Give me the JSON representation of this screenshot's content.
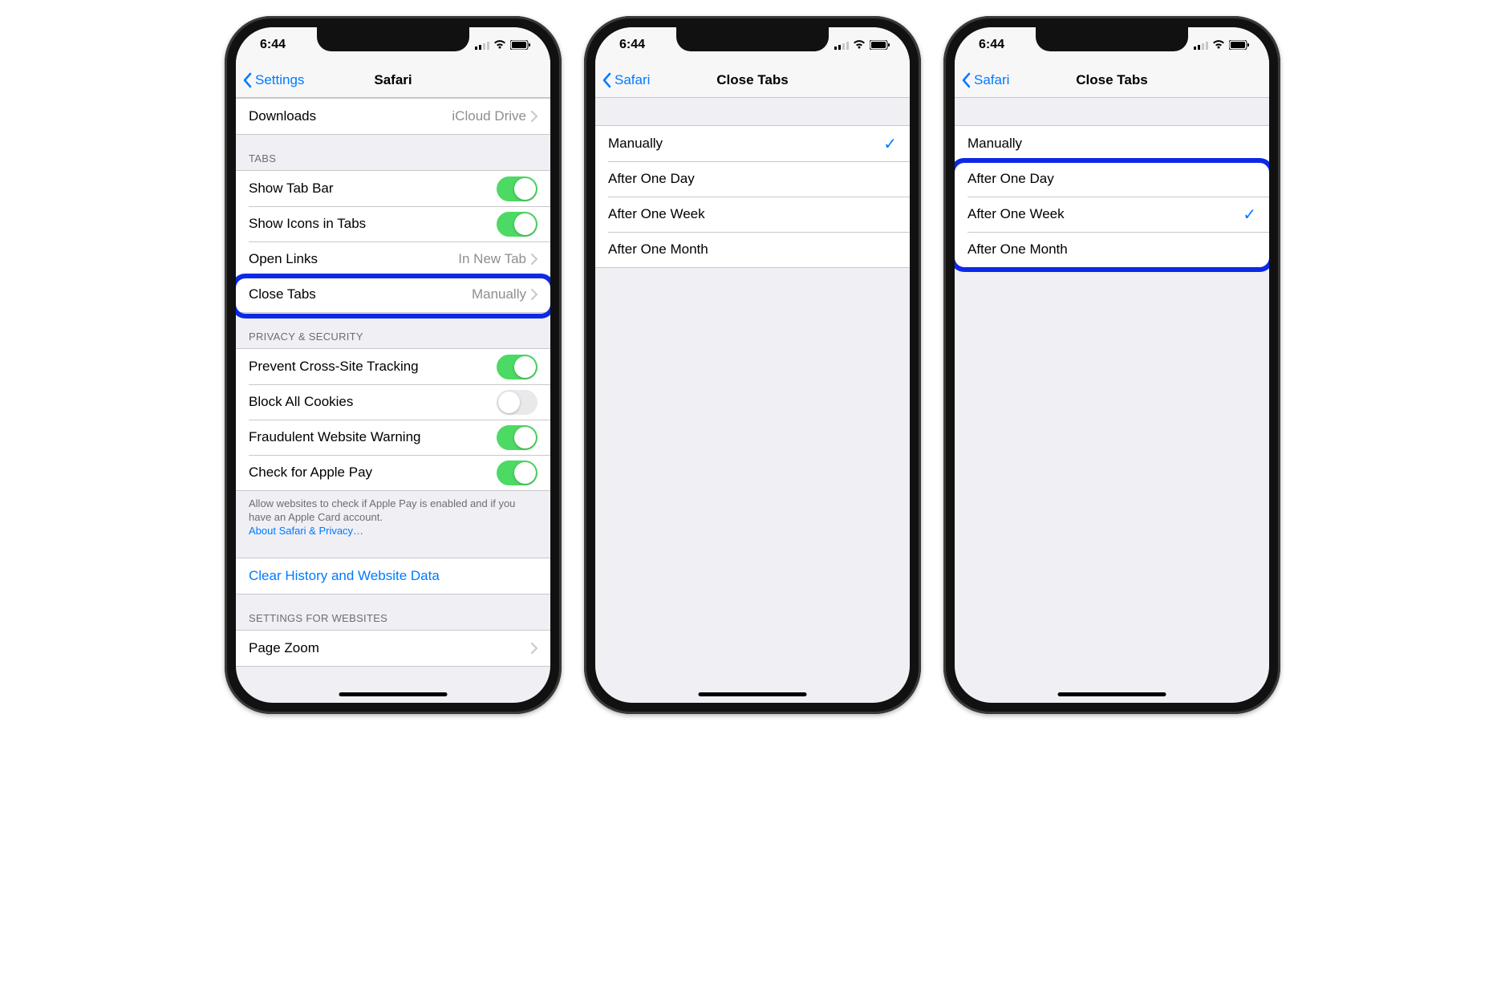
{
  "status": {
    "time": "6:44"
  },
  "phone1": {
    "back": "Settings",
    "title": "Safari",
    "downloads": {
      "label": "Downloads",
      "value": "iCloud Drive"
    },
    "tabsHeader": "Tabs",
    "showTabBar": "Show Tab Bar",
    "showIcons": "Show Icons in Tabs",
    "openLinks": {
      "label": "Open Links",
      "value": "In New Tab"
    },
    "closeTabs": {
      "label": "Close Tabs",
      "value": "Manually"
    },
    "privacyHeader": "Privacy & Security",
    "preventTracking": "Prevent Cross-Site Tracking",
    "blockCookies": "Block All Cookies",
    "fraudWarning": "Fraudulent Website Warning",
    "applePay": "Check for Apple Pay",
    "footerText": "Allow websites to check if Apple Pay is enabled and if you have an Apple Card account.",
    "footerLink": "About Safari & Privacy…",
    "clearHistory": "Clear History and Website Data",
    "websitesHeader": "Settings for Websites",
    "pageZoom": "Page Zoom"
  },
  "phone2": {
    "back": "Safari",
    "title": "Close Tabs",
    "options": [
      "Manually",
      "After One Day",
      "After One Week",
      "After One Month"
    ],
    "selected": "Manually"
  },
  "phone3": {
    "back": "Safari",
    "title": "Close Tabs",
    "options": [
      "Manually",
      "After One Day",
      "After One Week",
      "After One Month"
    ],
    "selected": "After One Week"
  }
}
